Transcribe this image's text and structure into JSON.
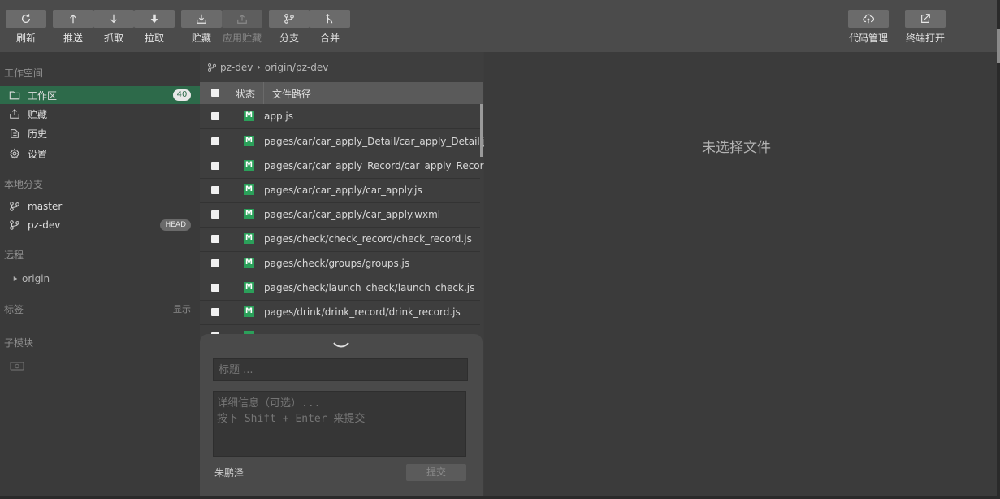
{
  "toolbar": {
    "refresh": "刷新",
    "push": "推送",
    "fetch": "抓取",
    "pull": "拉取",
    "stash": "贮藏",
    "apply_stash": "应用贮藏",
    "branch": "分支",
    "merge": "合并",
    "code_manage": "代码管理",
    "open_terminal": "终端打开"
  },
  "sidebar": {
    "workspace_title": "工作空间",
    "workspace_items": [
      {
        "label": "工作区",
        "count": "40"
      },
      {
        "label": "贮藏"
      },
      {
        "label": "历史"
      },
      {
        "label": "设置"
      }
    ],
    "local_branches_title": "本地分支",
    "branches": [
      {
        "label": "master"
      },
      {
        "label": "pz-dev",
        "badge": "HEAD"
      }
    ],
    "remote_title": "远程",
    "remote_item": "origin",
    "tags_title": "标签",
    "tags_show": "显示",
    "submodules_title": "子模块"
  },
  "branchbar": {
    "local": "pz-dev",
    "remote": "origin/pz-dev"
  },
  "filelist": {
    "col_status": "状态",
    "col_path": "文件路径",
    "files": [
      {
        "status": "M",
        "path": "app.js"
      },
      {
        "status": "M",
        "path": "pages/car/car_apply_Detail/car_apply_Detail.js"
      },
      {
        "status": "M",
        "path": "pages/car/car_apply_Record/car_apply_Record.js"
      },
      {
        "status": "M",
        "path": "pages/car/car_apply/car_apply.js"
      },
      {
        "status": "M",
        "path": "pages/car/car_apply/car_apply.wxml"
      },
      {
        "status": "M",
        "path": "pages/check/check_record/check_record.js"
      },
      {
        "status": "M",
        "path": "pages/check/groups/groups.js"
      },
      {
        "status": "M",
        "path": "pages/check/launch_check/launch_check.js"
      },
      {
        "status": "M",
        "path": "pages/drink/drink_record/drink_record.js"
      }
    ]
  },
  "commit": {
    "title_placeholder": "标题 ...",
    "detail_placeholder": "详细信息（可选）...\n按下 Shift + Enter 来提交",
    "author": "朱鹏泽",
    "submit": "提交"
  },
  "rightpane": {
    "no_file": "未选择文件"
  },
  "colors": {
    "accent_active": "#2d6a4a",
    "modified_badge": "#2ba05a"
  }
}
